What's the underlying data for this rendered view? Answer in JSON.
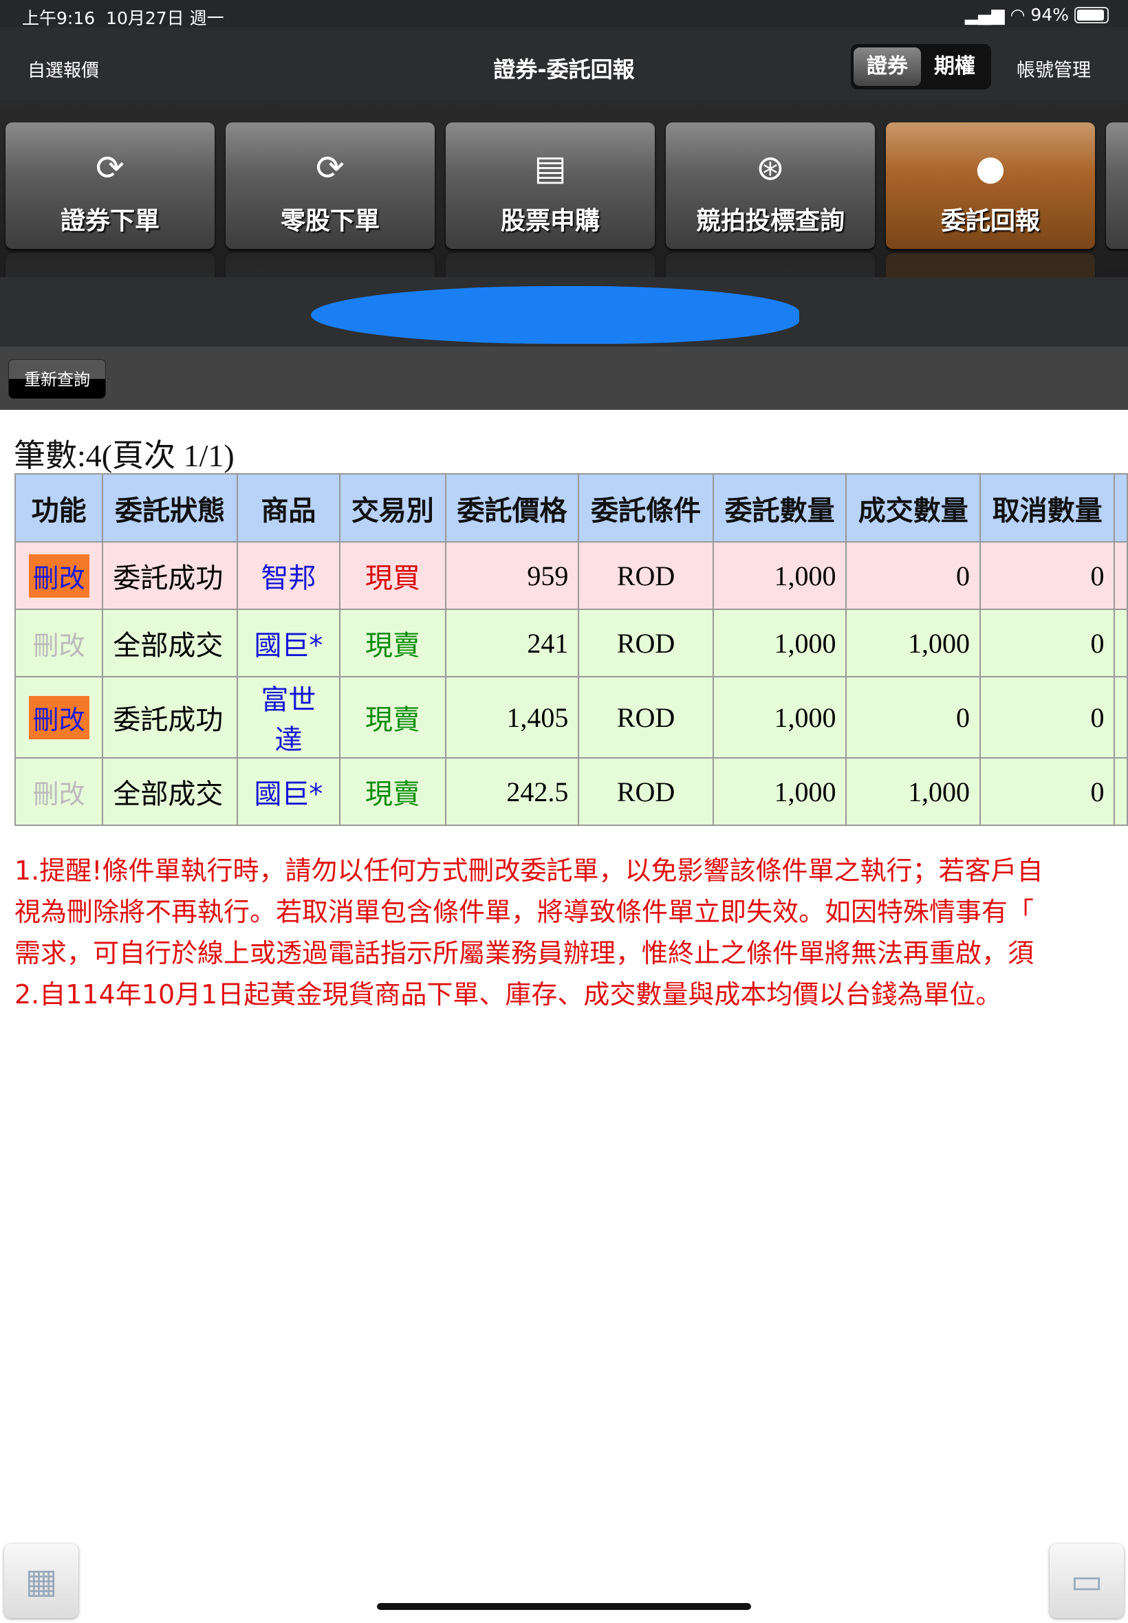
{
  "status": {
    "time": "上午9:16",
    "date": "10月27日 週一",
    "battery": "94%"
  },
  "header": {
    "left": "自選報價",
    "title": "證券-委託回報",
    "seg": [
      "證券",
      "期權"
    ],
    "account": "帳號管理"
  },
  "toolbar": [
    {
      "label": "證券下單",
      "icon": "dollar-cycle-icon"
    },
    {
      "label": "零股下單",
      "icon": "dollar-cycle-icon"
    },
    {
      "label": "股票申購",
      "icon": "document-dollar-icon"
    },
    {
      "label": "競拍投標查詢",
      "icon": "gavel-icon"
    },
    {
      "label": "委託回報",
      "icon": "person-icon",
      "active": true
    }
  ],
  "reload": "重新查詢",
  "count": "筆數:4(頁次 1/1)",
  "table": {
    "headers": [
      "功能",
      "委託狀態",
      "商品",
      "交易別",
      "委託價格",
      "委託條件",
      "委託數量",
      "成交數量",
      "取消數量"
    ],
    "rows": [
      {
        "action": "刪改",
        "status": "委託成功",
        "product": "智邦",
        "side": "現買",
        "price": "959",
        "cond": "ROD",
        "qty": "1,000",
        "filled": "0",
        "cancel": "0"
      },
      {
        "action": "刪改",
        "status": "全部成交",
        "product": "國巨*",
        "side": "現賣",
        "price": "241",
        "cond": "ROD",
        "qty": "1,000",
        "filled": "1,000",
        "cancel": "0"
      },
      {
        "action": "刪改",
        "status": "委託成功",
        "product": "富世達",
        "side": "現賣",
        "price": "1,405",
        "cond": "ROD",
        "qty": "1,000",
        "filled": "0",
        "cancel": "0"
      },
      {
        "action": "刪改",
        "status": "全部成交",
        "product": "國巨*",
        "side": "現賣",
        "price": "242.5",
        "cond": "ROD",
        "qty": "1,000",
        "filled": "1,000",
        "cancel": "0"
      }
    ]
  },
  "notes": [
    "1.提醒!條件單執行時，請勿以任何方式刪改委託單，以免影響該條件單之執行；若客戶自",
    "視為刪除將不再執行。若取消單包含條件單，將導致條件單立即失效。如因特殊情事有「",
    "需求，可自行於線上或透過電話指示所屬業務員辦理，惟終止之條件單將無法再重啟，須",
    "2.自114年10月1日起黃金現貨商品下單、庫存、成交數量與成本均價以台錢為單位。"
  ]
}
